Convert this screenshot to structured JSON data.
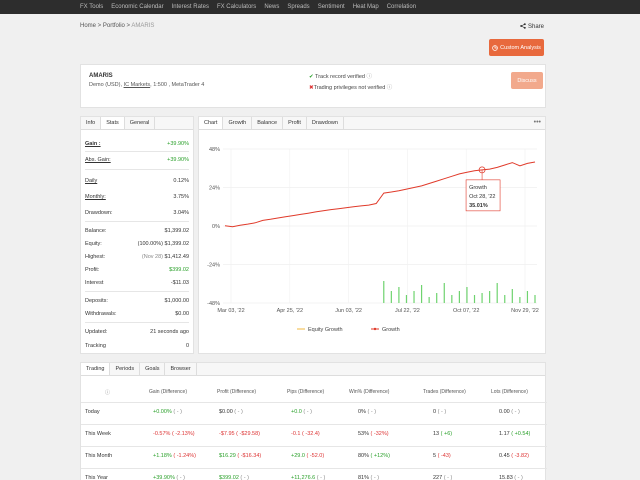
{
  "nav": [
    "FX Tools",
    "Economic Calendar",
    "Interest Rates",
    "FX Calculators",
    "News",
    "Spreads",
    "Sentiment",
    "Heat Map",
    "Correlation"
  ],
  "breadcrumb": {
    "home": "Home",
    "portfolio": "Portfolio",
    "current": "AMARIS",
    "sep": " > "
  },
  "share_label": "Share",
  "custom_analysis_label": "Custom Analysis",
  "account": {
    "name": "AMARIS",
    "type": "Demo (USD),",
    "broker": "IC Markets",
    "details": ", 1:500 , MetaTrader 4",
    "track_record": "Track record verified",
    "trading_privileges": "Trading privileges not verified",
    "discuss_label": "Discuss"
  },
  "stats_tabs": [
    "Info",
    "Stats",
    "General"
  ],
  "stats": {
    "gain": {
      "label": "Gain :",
      "value": "+39.90%"
    },
    "abs_gain": {
      "label": "Abs. Gain:",
      "value": "+39.90%"
    },
    "daily": {
      "label": "Daily",
      "value": "0.12%"
    },
    "monthly": {
      "label": "Monthly:",
      "value": "3.75%"
    },
    "drawdown": {
      "label": "Drawdown:",
      "value": "3.04%"
    },
    "balance": {
      "label": "Balance:",
      "value": "$1,399.02"
    },
    "equity": {
      "label": "Equity:",
      "pre": "(100.00%)",
      "value": "$1,399.02"
    },
    "highest": {
      "label": "Highest:",
      "pre": "(Nov 28)",
      "value": "$1,412.49"
    },
    "profit": {
      "label": "Profit:",
      "value": "$399.02"
    },
    "interest": {
      "label": "Interest",
      "value": "-$11.03"
    },
    "deposits": {
      "label": "Deposits:",
      "value": "$1,000.00"
    },
    "withdrawals": {
      "label": "Withdrawals:",
      "value": "$0.00"
    },
    "updated": {
      "label": "Updated:",
      "value": "21 seconds ago"
    },
    "tracking": {
      "label": "Tracking",
      "value": "0"
    }
  },
  "chart_tabs": [
    "Chart",
    "Growth",
    "Balance",
    "Profit",
    "Drawdown"
  ],
  "chart_data": {
    "type": "line",
    "y_ticks": [
      "48%",
      "24%",
      "0%",
      "-24%",
      "-48%"
    ],
    "ylim": [
      -48,
      48
    ],
    "x_ticks": [
      "Mar 03, '22",
      "Apr 25, '22",
      "Jun 03, '22",
      "Jul 22, '22",
      "Oct 07, '22",
      "Nov 29, '22"
    ],
    "series": [
      {
        "name": "Growth",
        "color": "#e03a2a",
        "values": [
          0.2,
          -0.5,
          0.5,
          1.2,
          2.0,
          3.5,
          4.2,
          5.0,
          5.8,
          6.5,
          7.2,
          8.0,
          8.8,
          9.5,
          10.2,
          10.8,
          11.4,
          12.0,
          12.5,
          13.0,
          14.0,
          20.5,
          21.2,
          22.0,
          23.0,
          24.0,
          25.0,
          26.5,
          28.0,
          29.5,
          31.0,
          32.5,
          33.5,
          34.5,
          35.0,
          35.5,
          36.5,
          38.0,
          39.5,
          37.5,
          39.0,
          39.9
        ]
      },
      {
        "name": "Equity Growth",
        "color": "#f0b840"
      }
    ],
    "volume": [
      0,
      0,
      0,
      0,
      0,
      0,
      0,
      0,
      0,
      0,
      0,
      0,
      0,
      0,
      0,
      0,
      0,
      0,
      0,
      0,
      0,
      0.55,
      0.3,
      0.4,
      0.2,
      0.3,
      0.45,
      0.15,
      0.25,
      0.5,
      0.2,
      0.3,
      0.4,
      0.2,
      0.25,
      0.3,
      0.5,
      0.2,
      0.35,
      0.15,
      0.3,
      0.2
    ],
    "tooltip": {
      "title": "Growth",
      "date": "Oct 28, '22",
      "value": "35.01%"
    }
  },
  "period_tabs": [
    "Trading",
    "Periods",
    "Goals",
    "Browser"
  ],
  "periods": {
    "headers": [
      "Gain (Difference)",
      "Profit (Difference)",
      "Pips (Difference)",
      "Win% (Difference)",
      "Trades (Difference)",
      "Lots (Difference)"
    ],
    "rows": [
      {
        "label": "Today",
        "gain": "+0.00%",
        "gain_d": "( - )",
        "profit": "$0.00",
        "profit_d": "( - )",
        "pips": "+0.0",
        "pips_d": "( - )",
        "win": "0%",
        "win_d": "( - )",
        "trades": "0",
        "trades_d": "( - )",
        "lots": "0.00",
        "lots_d": "( - )"
      },
      {
        "label": "This Week",
        "gain": "-0.57%",
        "gain_d": "( -2.13%)",
        "profit": "-$7.95",
        "profit_d": "( -$29.58)",
        "pips": "-0.1",
        "pips_d": "( -32.4)",
        "win": "53%",
        "win_d": "( -32%)",
        "trades": "13",
        "trades_d": "( +6)",
        "lots": "1.17",
        "lots_d": "( +0.54)"
      },
      {
        "label": "This Month",
        "gain": "+1.18%",
        "gain_d": "( -1.24%)",
        "profit": "$16.29",
        "profit_d": "( -$16.34)",
        "pips": "+29.0",
        "pips_d": "( -52.0)",
        "win": "80%",
        "win_d": "( +12%)",
        "trades": "5",
        "trades_d": "( -43)",
        "lots": "0.45",
        "lots_d": "( -3.82)"
      },
      {
        "label": "This Year",
        "gain": "+39.90%",
        "gain_d": "( - )",
        "profit": "$399.02",
        "profit_d": "( - )",
        "pips": "+11,276.6",
        "pips_d": "( - )",
        "win": "81%",
        "win_d": "( - )",
        "trades": "227",
        "trades_d": "( - )",
        "lots": "15.83",
        "lots_d": "( - )"
      }
    ]
  },
  "colors": {
    "accent": "#e8693d",
    "discuss": "#f2a98c",
    "positive": "#2aa02a",
    "negative": "#d33333"
  }
}
